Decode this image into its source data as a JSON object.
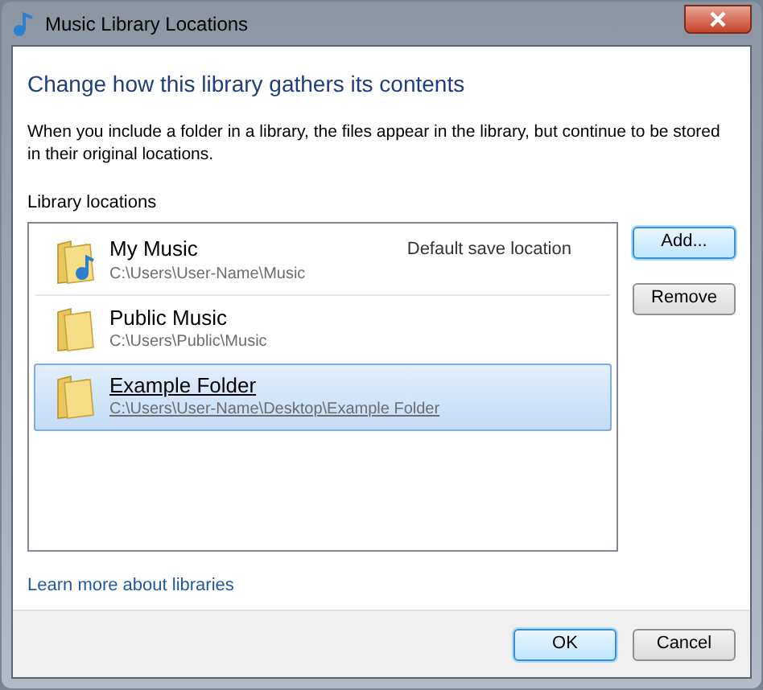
{
  "window": {
    "title": "Music Library Locations"
  },
  "heading": "Change how this library gathers its contents",
  "description": "When you include a folder in a library, the files appear in the library, but continue to be stored in their original locations.",
  "locations_label": "Library locations",
  "locations": [
    {
      "name": "My Music",
      "path": "C:\\Users\\User-Name\\Music",
      "note": "Default save location",
      "kind": "music-folder",
      "selected": false
    },
    {
      "name": "Public Music",
      "path": "C:\\Users\\Public\\Music",
      "kind": "folder",
      "selected": false
    },
    {
      "name": "Example Folder",
      "path": "C:\\Users\\User-Name\\Desktop\\Example Folder",
      "kind": "folder",
      "selected": true
    }
  ],
  "side_buttons": [
    {
      "label": "Add...",
      "default": true
    },
    {
      "label": "Remove",
      "default": false
    }
  ],
  "link": "Learn more about libraries",
  "footer_buttons": [
    {
      "label": "OK",
      "default": true
    },
    {
      "label": "Cancel",
      "default": false
    }
  ]
}
